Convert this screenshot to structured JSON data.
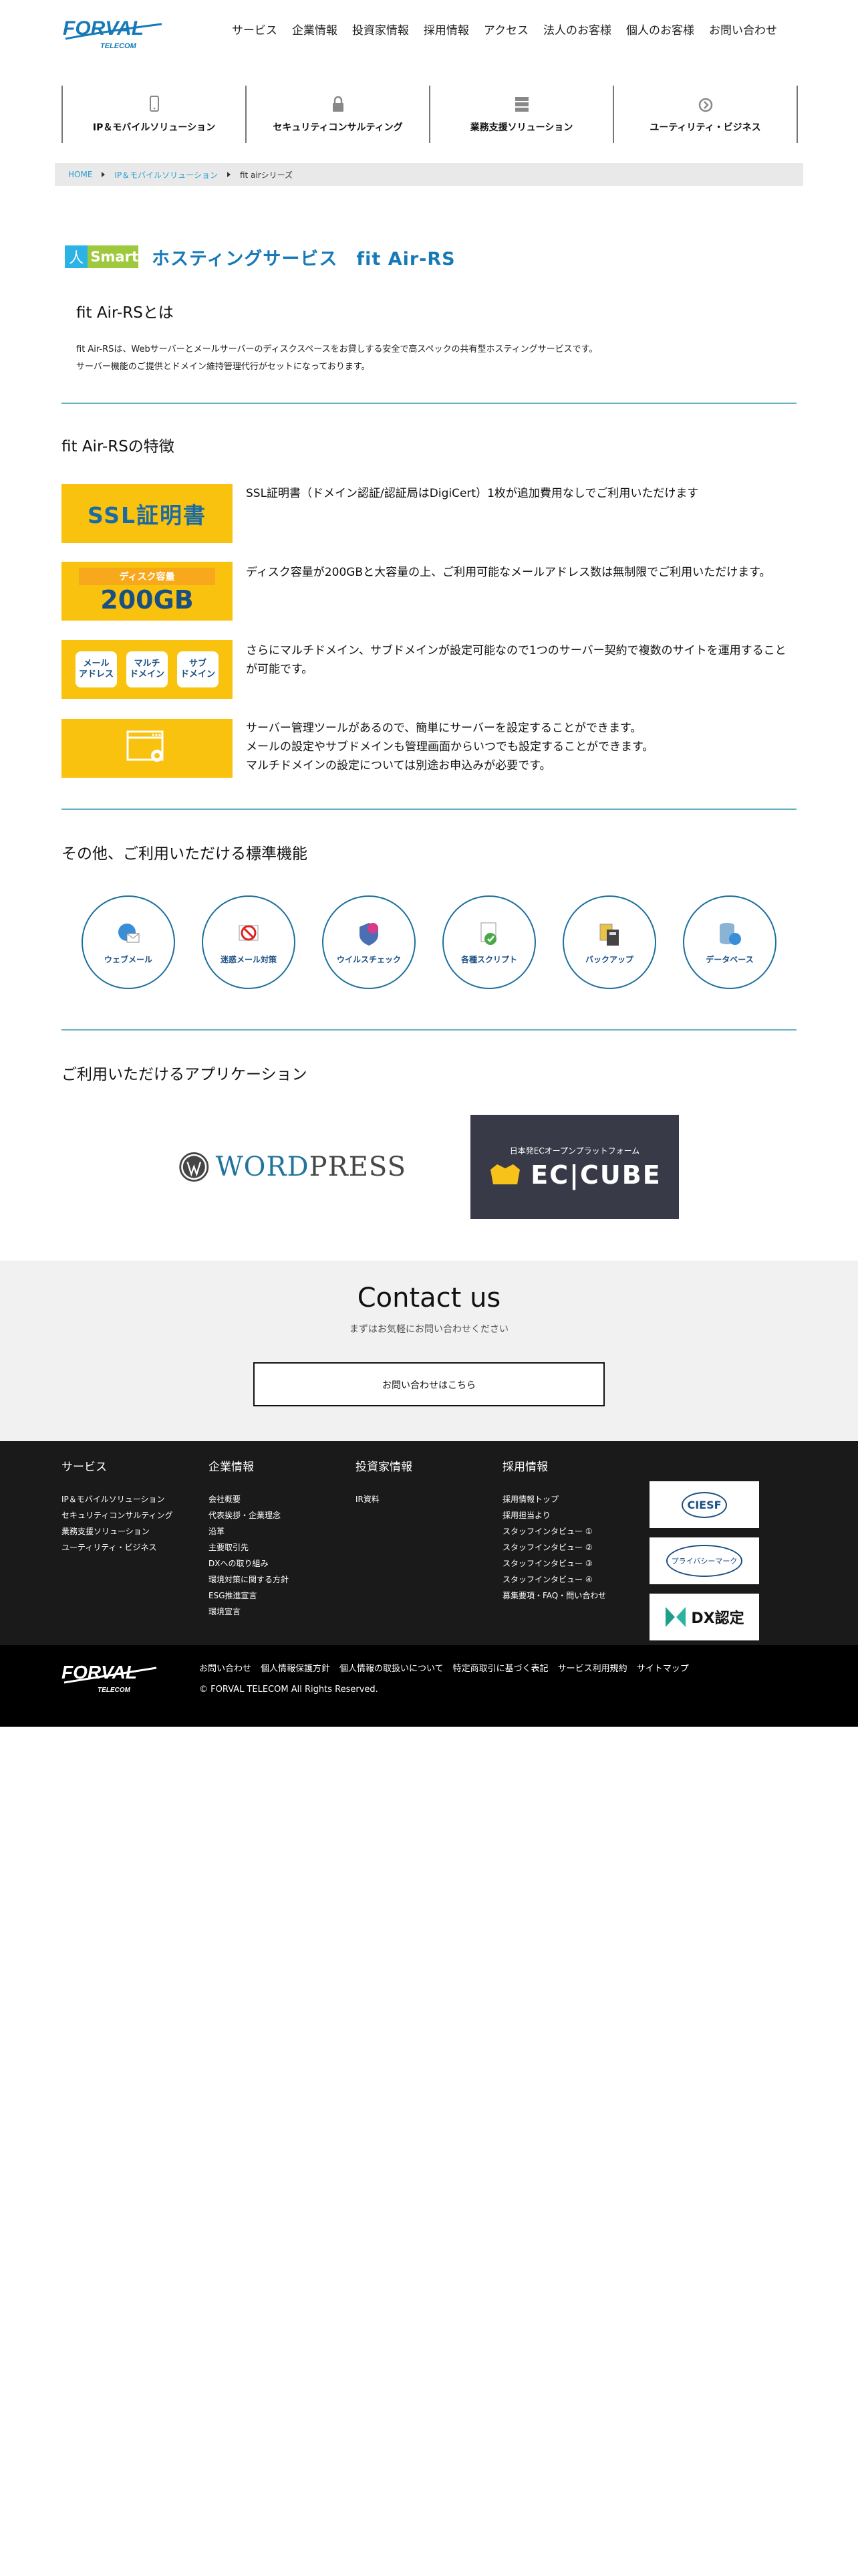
{
  "brand": {
    "logo_text": "FORVAL",
    "logo_sub": "TELECOM"
  },
  "nav": [
    "サービス",
    "企業情報",
    "投資家情報",
    "採用情報",
    "アクセス",
    "法人のお客様",
    "個人のお客様",
    "お問い合わせ"
  ],
  "categories": [
    {
      "label": "IP＆モバイルソリューション",
      "icon": "smartphone-icon"
    },
    {
      "label": "セキュリティコンサルティング",
      "icon": "lock-icon"
    },
    {
      "label": "業務支援ソリューション",
      "icon": "server-icon"
    },
    {
      "label": "ユーティリティ・ビジネス",
      "icon": "utility-icon"
    }
  ],
  "breadcrumb": {
    "home": "HOME",
    "parent": "IP＆モバイルソリューション",
    "current": "fit airシリーズ"
  },
  "title": {
    "badge_left": "人",
    "badge": "Smart",
    "text": "ホスティングサービス　fit Air-RS"
  },
  "intro": {
    "heading": "fit Air-RSとは",
    "lines": [
      "fit Air-RSは、Webサーバーとメールサーバーのディスクスペースをお貸しする安全で高スペックの共有型ホスティングサービスです。",
      "サーバー機能のご提供とドメイン維持管理代行がセットになっております。"
    ]
  },
  "features": {
    "heading": "fit Air-RSの特徴",
    "ssl_image": "SSL証明書",
    "disk_label": "ディスク容量",
    "disk_value": "200GB",
    "pills": [
      "メール\nアドレス",
      "マルチ\nドメイン",
      "サブ\nドメイン"
    ],
    "items": [
      [
        "SSL証明書（ドメイン認証/認証局はDigiCert）1枚が追加費用なしでご利用いただけます"
      ],
      [
        "ディスク容量が200GBと大容量の上、ご利用可能なメールアドレス数は無制限でご利用いただけます。"
      ],
      [
        "さらにマルチドメイン、サブドメインが設定可能なので1つのサーバー契約で複数のサイトを運用することが可能です。"
      ],
      [
        "サーバー管理ツールがあるので、簡単にサーバーを設定することができます。",
        "メールの設定やサブドメインも管理画面からいつでも設定することができます。",
        "マルチドメインの設定については別途お申込みが必要です。"
      ]
    ]
  },
  "standard": {
    "heading": "その他、ご利用いただける標準機能",
    "items": [
      {
        "label": "ウェブメール",
        "icon": "webmail-icon"
      },
      {
        "label": "迷惑メール対策",
        "icon": "spam-filter-icon"
      },
      {
        "label": "ウイルスチェック",
        "icon": "virus-check-icon"
      },
      {
        "label": "各種スクリプト",
        "icon": "script-icon"
      },
      {
        "label": "バックアップ",
        "icon": "backup-icon"
      },
      {
        "label": "データベース",
        "icon": "database-icon"
      }
    ]
  },
  "apps": {
    "heading": "ご利用いただけるアプリケーション",
    "wordpress_a": "WORD",
    "wordpress_b": "PRESS",
    "eccube_small": "日本発ECオープンプラットフォーム",
    "eccube_big": "EC|CUBE"
  },
  "contact": {
    "heading": "Contact us",
    "sub": "まずはお気軽にお問い合わせください",
    "button": "お問い合わせはこちら"
  },
  "footer": {
    "cols": [
      {
        "title": "サービス",
        "links": [
          "IP＆モバイルソリューション",
          "セキュリティコンサルティング",
          "業務支援ソリューション",
          "ユーティリティ・ビジネス"
        ]
      },
      {
        "title": "企業情報",
        "links": [
          "会社概要",
          "代表挨拶・企業理念",
          "沿革",
          "主要取引先",
          "DXへの取り組み",
          "環境対策に関する方針",
          "ESG推進宣言",
          "環境宣言"
        ]
      },
      {
        "title": "投資家情報",
        "links": [
          "IR資料"
        ]
      },
      {
        "title": "採用情報",
        "links": [
          "採用情報トップ",
          "採用担当より",
          "スタッフインタビュー ①",
          "スタッフインタビュー ②",
          "スタッフインタビュー ③",
          "スタッフインタビュー ④",
          "募集要項・FAQ・問い合わせ"
        ]
      }
    ],
    "badges": [
      "CIESF",
      "プライバシーマーク",
      "DX認定"
    ],
    "bottom_links": [
      "お問い合わせ",
      "個人情報保護方針",
      "個人情報の取扱いについて",
      "特定商取引に基づく表記",
      "サービス利用規約",
      "サイトマップ"
    ],
    "copyright": "© FORVAL TELECOM All Rights Reserved."
  },
  "colors": {
    "accent": "#1779b8",
    "yellow": "#f9c20e",
    "rule": "#6ab0c4",
    "footer_bg": "#1a1a1a"
  }
}
